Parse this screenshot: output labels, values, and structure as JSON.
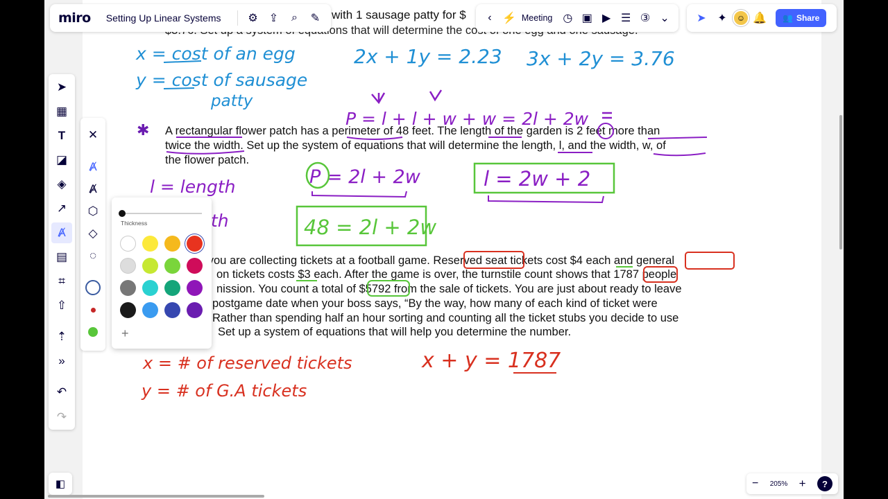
{
  "app": {
    "logo": "miro",
    "board_title": "Setting Up Linear Systems"
  },
  "topbar": {
    "meeting_label": "Meeting",
    "share_label": "Share",
    "icons": [
      "gear-icon",
      "export-icon",
      "search-icon",
      "magic-icon",
      "chevron-left-icon",
      "lightning-icon",
      "timer-icon",
      "present-icon",
      "video-icon",
      "notes-icon",
      "card-3-icon",
      "chevron-down-icon",
      "cursor-icon",
      "celebrate-icon",
      "bell-icon",
      "people-icon"
    ]
  },
  "document": {
    "problem1_header_partial": "with 1 sausage patty for $",
    "problem1_line2": "$3.76.  Set up a system of equations that will determine the cost of one egg and one sausage.",
    "problem2_line1": "A rectangular flower patch has a perimeter of 48 feet. The length of the garden is 2 feet more than",
    "problem2_line2": "twice the width.  Set up the system of equations that will determine the length, l, and the width, w, of",
    "problem2_line3": "the flower patch.",
    "problem3_line1": "e you are collecting tickets at a football game.  Reserved seat tickets cost $4 each and general",
    "problem3_line2": "on tickets costs $3 each.  After the game is over, the turnstile count shows that 1787 people",
    "problem3_line3": "nission.  You count a total of $5792 from the sale of tickets.  You are just about ready to leave",
    "problem3_line4": "postgame date when your boss says, “By the way, how many of each kind of ticket were",
    "problem3_line5": "Rather than spending half an hour sorting and counting all the ticket stubs you decide to use",
    "problem3_line6": "Set up a system of equations that will help you determine the number."
  },
  "handwriting": {
    "x_def": "x = cost of an egg",
    "y_def1": "y = cost of sausage",
    "y_def2": "patty",
    "eq1": "2x + 1y = 2.23",
    "eq2": "3x + 2y = 3.76",
    "perimeter_formula": "P = l + l + w + w = 2l + 2w",
    "l_def": "l = length",
    "w_def_partial": "th",
    "p_eq": "P = 2l + 2w",
    "l_eq": "l = 2w + 2",
    "p48_eq": "48 = 2l + 2w",
    "x_def3": "x = # of reserved tickets",
    "y_def3": "y = # of G.A tickets",
    "xy_eq": "x + y = 1787"
  },
  "ink_colors": {
    "blue": "#1f8fd4",
    "purple": "#8a1ec4",
    "green": "#58c63a",
    "red": "#d8301f"
  },
  "left_toolbar": {
    "tools": [
      "select-icon",
      "frame-icon",
      "text-icon",
      "sticky-note-icon",
      "shapes-icon",
      "connection-line-icon",
      "pen-icon",
      "comment-icon",
      "crop-icon",
      "upload-icon",
      "apps-icon",
      "more-tools-icon",
      "undo-icon",
      "redo-icon"
    ],
    "active_tool": "pen-icon"
  },
  "pen_panel": {
    "tools": [
      "close-icon",
      "pen-tool-icon",
      "highlighter-icon",
      "smart-draw-icon",
      "eraser-icon",
      "lasso-icon"
    ]
  },
  "color_popup": {
    "thickness_label": "Thickness",
    "thickness_value": 0,
    "colors": [
      "#ffffff",
      "#fce93b",
      "#f5b91d",
      "#e8331f",
      "#dddddd",
      "#c6e832",
      "#7ad53b",
      "#cf0c5a",
      "#777777",
      "#2ad1d1",
      "#14a57a",
      "#8f16b8",
      "#1a1a1a",
      "#3a9bf0",
      "#3647b0",
      "#6a1db0"
    ],
    "selected_color": "#e8331f",
    "add_label": "+"
  },
  "pen_presets": [
    "#1f3d7a",
    "#c62828",
    "#58c63a"
  ],
  "zoom": {
    "level": "205%",
    "minus": "−",
    "plus": "+",
    "help": "?"
  }
}
